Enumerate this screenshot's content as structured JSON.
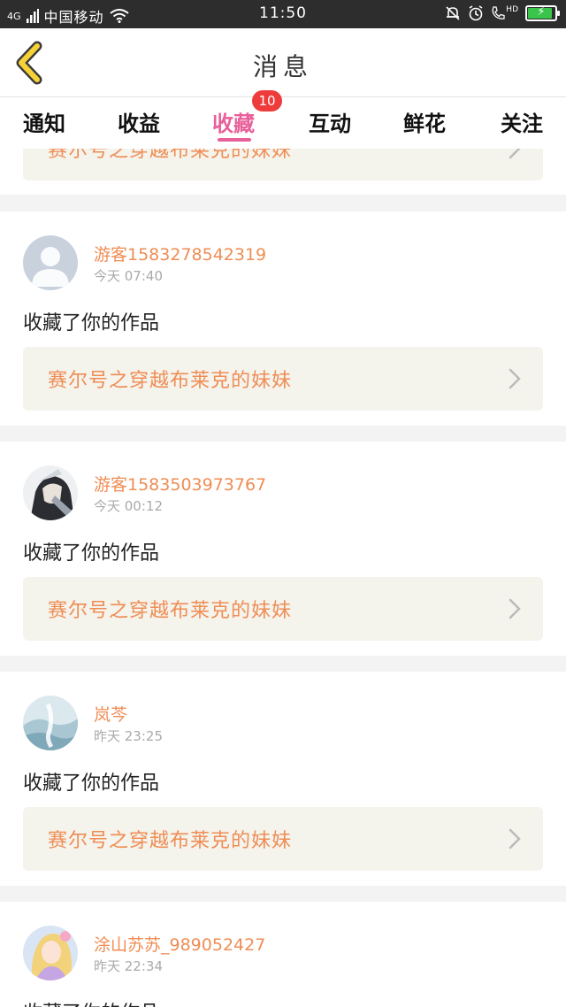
{
  "status_bar": {
    "signal": "4G",
    "carrier": "中国移动",
    "time": "11:50",
    "hd": "HD",
    "battery_level": 0.9,
    "battery_color": "#39c54a"
  },
  "header": {
    "title": "消息",
    "back_icon": "chevron-left-icon"
  },
  "tabs": {
    "items": [
      "通知",
      "收益",
      "收藏",
      "互动",
      "鲜花",
      "关注"
    ],
    "active_index": 2,
    "badge_count": "10",
    "active_color": "#e8609a"
  },
  "partial_card": {
    "work_title": "赛尔号之穿越布莱克的妹妹"
  },
  "cards": [
    {
      "username": "游客1583278542319",
      "time": "今天 07:40",
      "action": "收藏了你的作品",
      "work_title": "赛尔号之穿越布莱克的妹妹",
      "avatar": "default-person-avatar"
    },
    {
      "username": "游客1583503973767",
      "time": "今天 00:12",
      "action": "收藏了你的作品",
      "work_title": "赛尔号之穿越布莱克的妹妹",
      "avatar": "anime-character-avatar"
    },
    {
      "username": "岚芩",
      "time": "昨天 23:25",
      "action": "收藏了你的作品",
      "work_title": "赛尔号之穿越布莱克的妹妹",
      "avatar": "landscape-avatar"
    },
    {
      "username": "涂山苏苏_989052427",
      "time": "昨天 22:34",
      "action": "收藏了你的作品",
      "avatar": "anime-girl-avatar"
    }
  ],
  "colors": {
    "accent": "#ef8d54",
    "link_bg": "#f4f3ec",
    "badge": "#ee3b3b"
  }
}
